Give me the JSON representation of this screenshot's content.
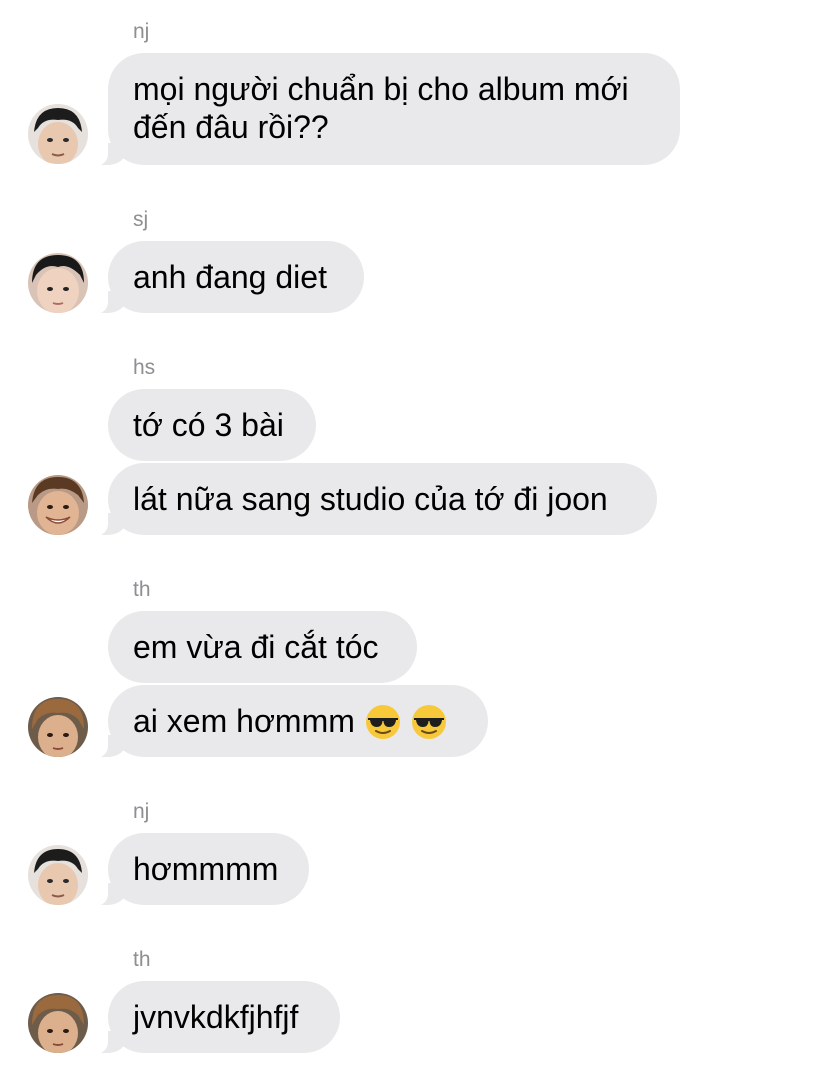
{
  "messages": [
    {
      "sender": "nj",
      "bubbles": [
        "mọi người chuẩn bị cho album mới",
        "đến đâu rồi??"
      ]
    },
    {
      "sender": "sj",
      "bubbles": [
        "anh đang diet"
      ]
    },
    {
      "sender": "hs",
      "bubbles": [
        "tớ có 3 bài",
        "lát nữa sang studio của tớ đi joon"
      ]
    },
    {
      "sender": "th",
      "bubbles": [
        "em vừa đi cắt tóc",
        "ai xem hơmmm"
      ]
    },
    {
      "sender": "nj",
      "bubbles": [
        "hơmmmm"
      ]
    },
    {
      "sender": "th",
      "bubbles": [
        "jvnvkdkfjhfjf"
      ]
    }
  ],
  "emojis": [
    "smiling-face-with-sunglasses",
    "smiling-face-with-sunglasses"
  ],
  "colors": {
    "bubble": "#e9e9eb",
    "sender_label": "#8e8e93",
    "text": "#000000",
    "background": "#ffffff"
  }
}
